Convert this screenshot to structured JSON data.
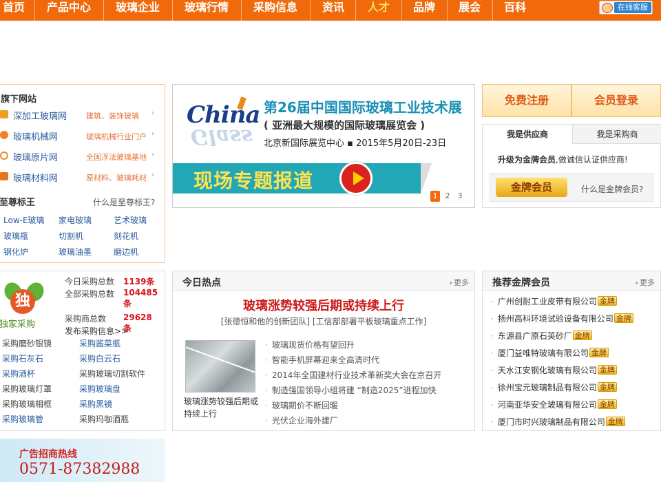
{
  "nav": {
    "items": [
      "首页",
      "产品中心",
      "玻璃企业",
      "玻璃行情",
      "采购信息",
      "资讯",
      "人才",
      "品牌",
      "展会",
      "百科"
    ],
    "kefu": "在线客服"
  },
  "sites": {
    "title": "旗下网站",
    "items": [
      {
        "name": "深加工玻璃网",
        "desc": "建筑、装饰玻璃"
      },
      {
        "name": "玻璃机械网",
        "desc": "玻璃机械行业门户"
      },
      {
        "name": "玻璃原片网",
        "desc": "全国浮法玻璃基地"
      },
      {
        "name": "玻璃材料网",
        "desc": "原材料、玻璃耗材"
      }
    ],
    "zz_title": "至尊标王",
    "zz_what": "什么是至尊标王?",
    "zz_links": [
      "Low-E玻璃",
      "家电玻璃",
      "艺术玻璃",
      "玻璃瓶",
      "切割机",
      "刻花机",
      "钢化炉",
      "玻璃油墨",
      "磨边机"
    ]
  },
  "banner": {
    "logo_top": "China",
    "logo_bottom": "Glass",
    "title": "第26届中国国际玻璃工业技术展",
    "subtitle": "( 亚洲最大规模的国际玻璃展览会 )",
    "place": "北京新国际展览中心 ▪ 2015年5月20日-23日",
    "report": "现场专题报道",
    "pages": [
      "1",
      "2",
      "3"
    ]
  },
  "account": {
    "register": "免费注册",
    "login": "会员登录",
    "tab_supplier": "我是供应商",
    "tab_buyer": "我是采购商",
    "upgrade_bold": "升级为金牌会员",
    "upgrade_rest": ",做诚信认证供应商!",
    "gold_badge": "金牌会员",
    "gold_what": "什么是金牌会员?"
  },
  "purchase": {
    "logo_char": "独",
    "logo_label": "独家采购",
    "stats": [
      {
        "label": "今日采购总数",
        "value": "1139条"
      },
      {
        "label": "全部采购总数",
        "value": "104485条"
      },
      {
        "label": "采购商总数",
        "value": "29628条"
      }
    ],
    "publish": "发布采购信息>>",
    "links_left": [
      "采购磨砂银镜",
      "采购石灰石",
      "采购酒杯",
      "采购玻璃灯罩",
      "采购玻璃相框",
      "采购玻璃管"
    ],
    "links_right": [
      "采购酱菜瓶",
      "采购白云石",
      "采购玻璃切割软件",
      "采购玻璃盘",
      "采购黑镜",
      "采购玛咖酒瓶"
    ]
  },
  "hot": {
    "title": "今日热点",
    "more": "更多",
    "headline": "玻璃涨势较强后期或持续上行",
    "sub": "[张德恒和他的创新团队] [工信部部署平板玻璃重点工作]",
    "img_caption": "玻璃涨势较强后期或持续上行",
    "list": [
      "玻璃现货价格有望回升",
      "智能手机屏幕迎来全高清时代",
      "2014年全国建材行业技术革新奖大会在京召开",
      "制造强国领导小组将建 “制造2025”进程加快",
      "玻璃期价不断回暖",
      "光伏企业海外建厂"
    ]
  },
  "gold": {
    "title": "推荐金牌会员",
    "more": "更多",
    "tag": "金牌",
    "companies": [
      "广州创耐工业皮带有限公司",
      "扬州高科环境试验设备有限公司",
      "东源县广原石英砂厂",
      "厦门益唯特玻璃有限公司",
      "天水江安钢化玻璃有限公司",
      "徐州宝元玻璃制品有限公司",
      "河南亚华安全玻璃有限公司",
      "厦门市时兴玻璃制品有限公司"
    ]
  },
  "ad": {
    "title": "广告招商热线",
    "phone": "0571-87382988"
  },
  "colors": {
    "nav_bg": "#f06a0c",
    "link_blue": "#2a5c9e",
    "red": "#d8121b",
    "gold": "#e7a614"
  }
}
